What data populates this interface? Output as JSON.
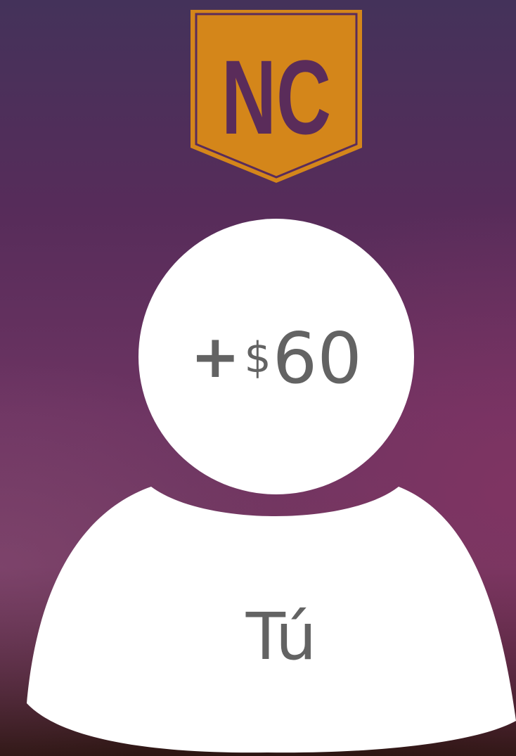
{
  "logo": {
    "text": "NC",
    "colors": {
      "fill": "#d4861a",
      "text": "#5a2c5a",
      "border": "#d4861a"
    }
  },
  "avatar": {
    "sign": "+",
    "currency": "$",
    "value": "60",
    "label": "Tú",
    "colors": {
      "fill": "#ffffff",
      "text": "#636363"
    }
  },
  "background": {
    "colors": {
      "top": "#44325a",
      "middle": "#6d3462",
      "bottom": "#2d1612"
    }
  }
}
